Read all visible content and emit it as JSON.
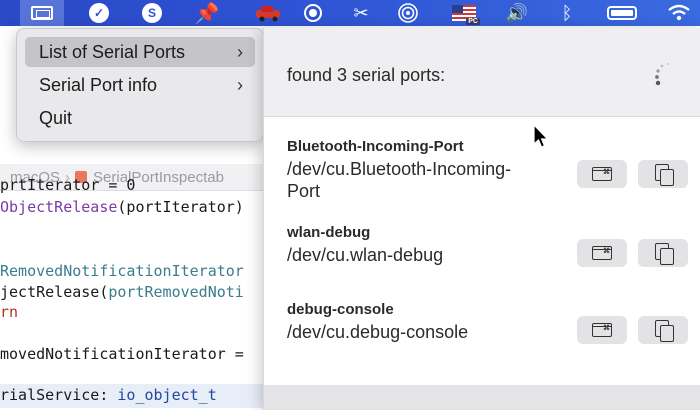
{
  "menubar": {
    "icons": [
      "serial-app-icon",
      "checkmark-icon",
      "skype-icon",
      "pin-icon",
      "red-car-icon",
      "record-icon",
      "scissors-icon",
      "airdrop-icon",
      "us-flag-icon",
      "volume-icon",
      "bluetooth-icon",
      "battery-icon",
      "wifi-icon"
    ],
    "flag_badge": "PC",
    "active_color": "#5774d8"
  },
  "editor": {
    "breadcrumb": [
      "macOS",
      "SerialPortInspectab"
    ],
    "lines": [
      {
        "plain": "rtIterator = 0"
      },
      {
        "call": "ObjectRelease",
        "rest": "(portIterator)"
      },
      {
        "ident": "RemovedNotificationIterator"
      },
      {
        "pre": "jectRelease(",
        "ident": "portRemovedNoti"
      },
      {
        "keyword": "rn"
      },
      {
        "plain": "movedNotificationIterator ="
      },
      {
        "plain": "rialService: ",
        "type": "io_object_t"
      }
    ]
  },
  "menu": {
    "items": [
      {
        "label": "List of Serial Ports",
        "has_submenu": true,
        "selected": true
      },
      {
        "label": "Serial Port info",
        "has_submenu": true,
        "selected": false
      },
      {
        "label": "Quit",
        "has_submenu": false,
        "selected": false
      }
    ],
    "chevron": "›"
  },
  "panel": {
    "title": "found 3 serial ports:",
    "ports": [
      {
        "name": "Bluetooth-Incoming-Port",
        "path_line1": "/dev/cu.Bluetooth-Incoming-",
        "path_line2": "Port"
      },
      {
        "name": "wlan-debug",
        "path_line1": "/dev/cu.wlan-debug",
        "path_line2": ""
      },
      {
        "name": "debug-console",
        "path_line1": "/dev/cu.debug-console",
        "path_line2": ""
      }
    ],
    "button_icons": [
      "terminal-icon",
      "copy-icon"
    ]
  }
}
